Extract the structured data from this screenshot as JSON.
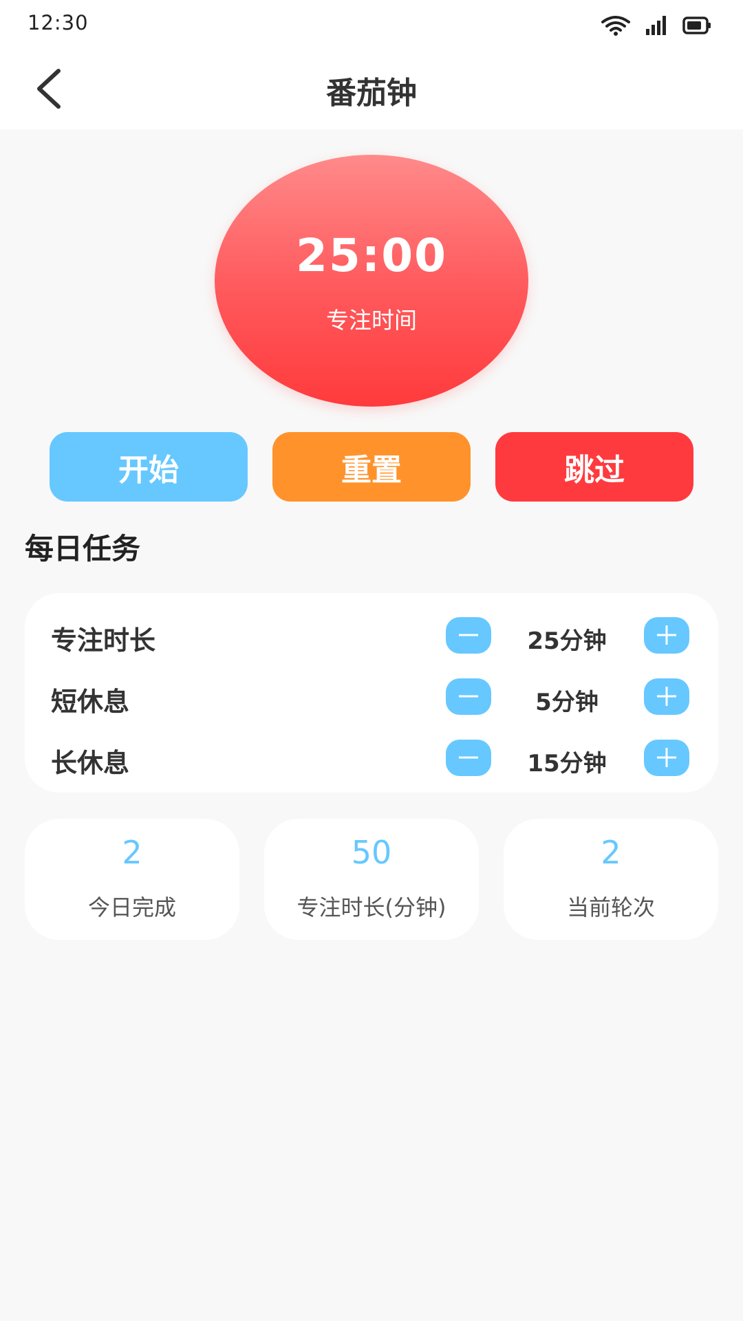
{
  "status_bar": {
    "time": "12:30",
    "icons": [
      "wifi-icon",
      "signal-icon",
      "battery-icon"
    ]
  },
  "app_bar": {
    "title": "番茄钟",
    "back_icon": "chevron-left-icon"
  },
  "timer": {
    "value": "25:00",
    "label": "专注时间",
    "gradient_top": "#ff8a8a",
    "gradient_bottom": "#ff3a3c"
  },
  "controls": {
    "start_label": "开始",
    "reset_label": "重置",
    "skip_label": "跳过",
    "start_color": "#66c8ff",
    "reset_color": "#ff922a",
    "skip_color": "#ff3a3e"
  },
  "section": {
    "title": "每日任务"
  },
  "settings": [
    {
      "label": "专注时长",
      "value": "25分钟"
    },
    {
      "label": "短休息",
      "value": "5分钟"
    },
    {
      "label": "长休息",
      "value": "15分钟"
    }
  ],
  "stats": [
    {
      "value": "2",
      "label": "今日完成"
    },
    {
      "value": "50",
      "label": "专注时长(分钟)"
    },
    {
      "value": "2",
      "label": "当前轮次"
    }
  ],
  "colors": {
    "accent": "#66c8ff",
    "background": "#f8f8f8",
    "card": "#ffffff"
  }
}
